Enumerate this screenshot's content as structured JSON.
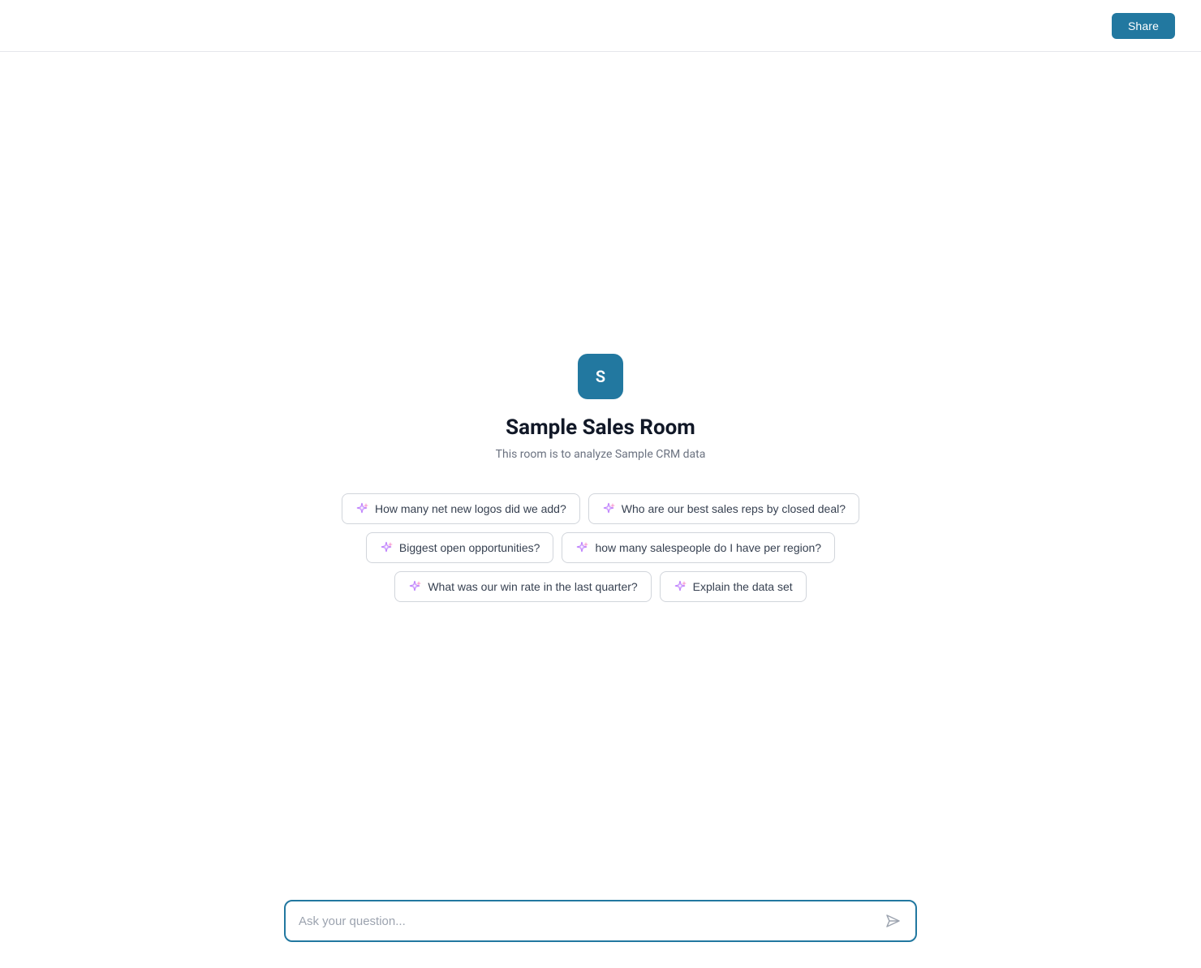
{
  "header": {
    "share_button_label": "Share"
  },
  "room": {
    "icon_letter": "S",
    "title": "Sample Sales Room",
    "subtitle": "This room is to analyze Sample CRM data"
  },
  "suggestions": {
    "rows": [
      [
        {
          "id": "chip-1",
          "text": "How many net new logos did we add?"
        },
        {
          "id": "chip-2",
          "text": "Who are our best sales reps by closed deal?"
        }
      ],
      [
        {
          "id": "chip-3",
          "text": "Biggest open opportunities?"
        },
        {
          "id": "chip-4",
          "text": "how many salespeople do I have per region?"
        }
      ],
      [
        {
          "id": "chip-5",
          "text": "What was our win rate in the last quarter?"
        },
        {
          "id": "chip-6",
          "text": "Explain the data set"
        }
      ]
    ]
  },
  "input": {
    "placeholder": "Ask your question..."
  }
}
